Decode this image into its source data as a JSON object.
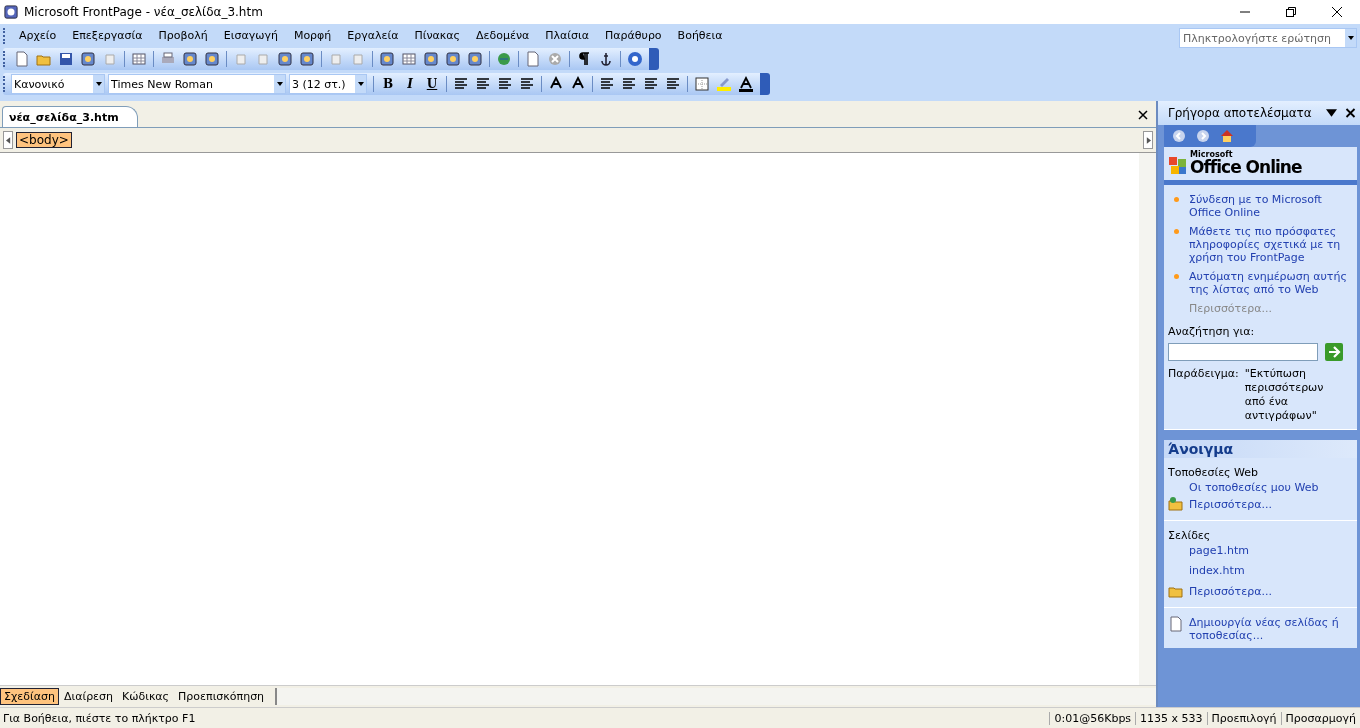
{
  "window": {
    "title": "Microsoft FrontPage - νέα_σελίδα_3.htm"
  },
  "menu": [
    "Αρχείο",
    "Επεξεργασία",
    "Προβολή",
    "Εισαγωγή",
    "Μορφή",
    "Εργαλεία",
    "Πίνακας",
    "Δεδομένα",
    "Πλαίσια",
    "Παράθυρο",
    "Βοήθεια"
  ],
  "help_search": {
    "placeholder": "Πληκτρολογήστε ερώτηση"
  },
  "formatting": {
    "style": "Κανονικό",
    "font": "Times New Roman",
    "size": "3  (12 στ.)",
    "bold": "B",
    "italic": "I",
    "underline": "U"
  },
  "document_tab": {
    "label": "νέα_σελίδα_3.htm",
    "selected": true
  },
  "tag_selector": [
    "<body>"
  ],
  "view_tabs": [
    {
      "label": "Σχεδίαση",
      "selected": true
    },
    {
      "label": "Διαίρεση",
      "selected": false
    },
    {
      "label": "Κώδικας",
      "selected": false
    },
    {
      "label": "Προεπισκόπηση",
      "selected": false
    }
  ],
  "task_pane": {
    "title": "Γρήγορα αποτελέσματα",
    "logo_small": "Microsoft",
    "logo": "Office Online",
    "links": [
      "Σύνδεση με το Microsoft Office Online",
      "Μάθετε τις πιο πρόσφατες πληροφορίες σχετικά με τη χρήση του FrontPage",
      "Αυτόματη ενημέρωση αυτής της λίστας από το Web"
    ],
    "more": "Περισσότερα...",
    "search_label": "Αναζήτηση για:",
    "example_label": "Παράδειγμα:",
    "example_text": "\"Εκτύπωση περισσότερων από ένα αντιγράφων\"",
    "open_header": "Άνοιγμα",
    "sites_label": "Τοποθεσίες Web",
    "sites": [
      "Οι τοποθεσίες μου Web"
    ],
    "sites_more": "Περισσότερα...",
    "pages_label": "Σελίδες",
    "pages": [
      "page1.htm",
      "index.htm"
    ],
    "pages_more": "Περισσότερα...",
    "create": "Δημιουργία νέας σελίδας ή τοποθεσίας..."
  },
  "status_bar": {
    "hint": "Για Βοήθεια, πιέστε το πλήκτρο F1",
    "speed": "0:01@56Kbps",
    "size": "1135 x 533",
    "mode1": "Προεπιλογή",
    "mode2": "Προσαρμογή"
  }
}
